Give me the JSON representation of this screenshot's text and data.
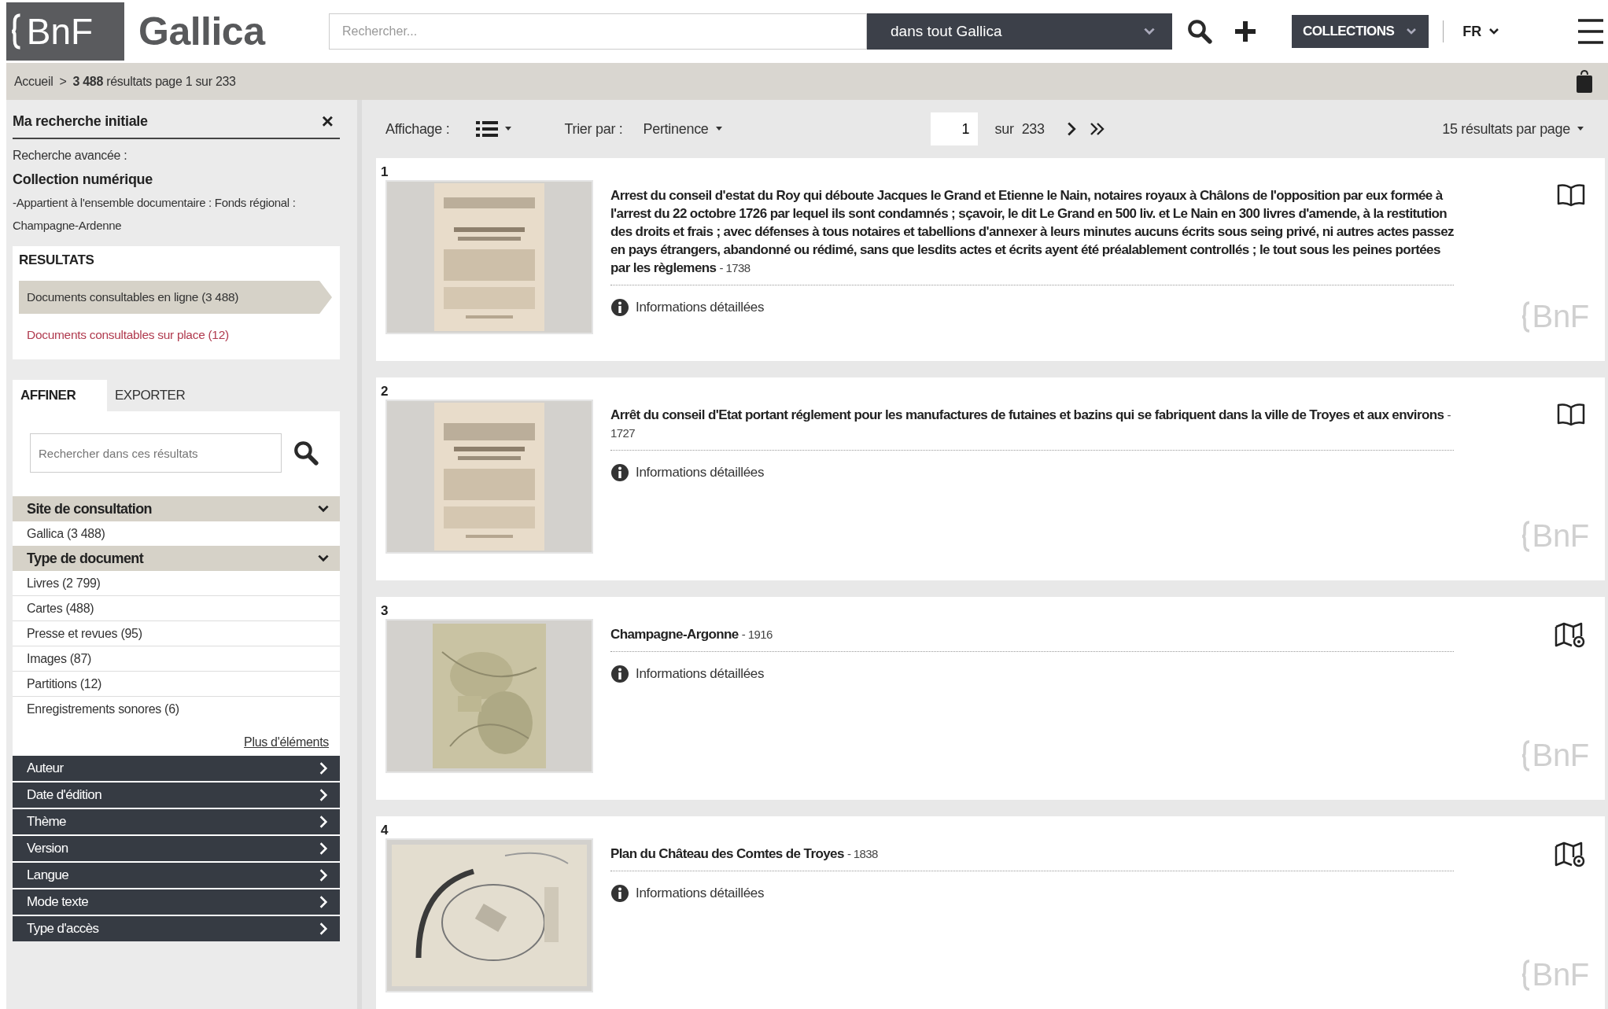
{
  "header": {
    "logo": "BnF",
    "site_name": "Gallica",
    "search": {
      "placeholder": "Rechercher..."
    },
    "scope": "dans tout Gallica",
    "collections": "COLLECTIONS",
    "language": "FR"
  },
  "breadcrumb": {
    "home": "Accueil",
    "separator": ">",
    "summary": "**3 488** résultats page 1 sur 233"
  },
  "sidebar": {
    "title": "Ma recherche initiale",
    "close": "×",
    "query": [
      {
        "text": "Recherche avancée :",
        "kind": "label"
      },
      {
        "text": "Collection numérique",
        "kind": "strong"
      },
      {
        "text": "-Appartient à l'ensemble documentaire : Fonds régional : Champagne-Ardenne",
        "kind": "note"
      }
    ],
    "results_box": {
      "heading": "RESULTATS",
      "items": [
        {
          "label": "Documents consultables en ligne (3 488)",
          "selected": true
        },
        {
          "label": "Documents consultables sur place (12)",
          "selected": false
        }
      ]
    },
    "tabs": [
      {
        "label": "AFFINER",
        "selected": true
      },
      {
        "label": "EXPORTER",
        "selected": false
      }
    ],
    "refine_search": {
      "placeholder": "Rechercher dans ces résultats"
    },
    "facets": [
      {
        "title": "Site de consultation",
        "expanded": true,
        "items": [
          "Gallica (3 488)"
        ]
      },
      {
        "title": "Type de document",
        "expanded": true,
        "items": [
          "Livres (2 799)",
          "Cartes (488)",
          "Presse et revues (95)",
          "Images (87)",
          "Partitions (12)",
          "Enregistrements sonores (6)"
        ],
        "more_link": "Plus d'éléments"
      },
      {
        "title": "Auteur",
        "expanded": false
      },
      {
        "title": "Date d'édition",
        "expanded": false
      },
      {
        "title": "Thème",
        "expanded": false
      },
      {
        "title": "Version",
        "expanded": false
      },
      {
        "title": "Langue",
        "expanded": false
      },
      {
        "title": "Mode texte",
        "expanded": false
      },
      {
        "title": "Type d'accès",
        "expanded": false
      }
    ]
  },
  "toolbar": {
    "display_label": "Affichage :",
    "view": {
      "kind": "list"
    },
    "sort_label": "Trier par :",
    "sort_value": "Pertinence",
    "page": "1",
    "page_of": "sur",
    "page_total": "233",
    "per_page": "15 résultats par page"
  },
  "results": [
    {
      "number": "1",
      "title": "Arrest du conseil d'estat du Roy qui déboute Jacques le Grand et Etienne le Nain, notaires royaux à Châlons de l'opposition par eux formée à l'arrest du 22 octobre 1726 par lequel ils sont condamnés ; sçavoir, le dit Le Grand en 500 liv. et Le Nain en 300 livres d'amende, à la restitution des droits et frais ; avec défenses à tous notaires et tabellions d'annexer à leurs minutes aucuns écrits sous seing privé, ni autres actes passez en pays étrangers, abandonné ou rédimé, sans que lesdits actes et écrits ayent été préalablement controllés ; le tout sous les peines portées par les règlemens",
      "year": "- 1738",
      "info": "Informations détaillées",
      "kind": "book",
      "watermark": "BnF"
    },
    {
      "number": "2",
      "title": "Arrêt du conseil d'Etat portant réglement pour les manufactures de futaines et bazins qui se fabriquent dans la ville de Troyes et aux environs",
      "year": "- 1727",
      "info": "Informations détaillées",
      "kind": "book",
      "watermark": "BnF"
    },
    {
      "number": "3",
      "title": "Champagne-Argonne",
      "year": "- 1916",
      "info": "Informations détaillées",
      "kind": "map",
      "watermark": "BnF"
    },
    {
      "number": "4",
      "title": "Plan du Château des Comtes de Troyes",
      "year": "- 1838",
      "info": "Informations détaillées",
      "kind": "map",
      "watermark": "BnF"
    }
  ]
}
